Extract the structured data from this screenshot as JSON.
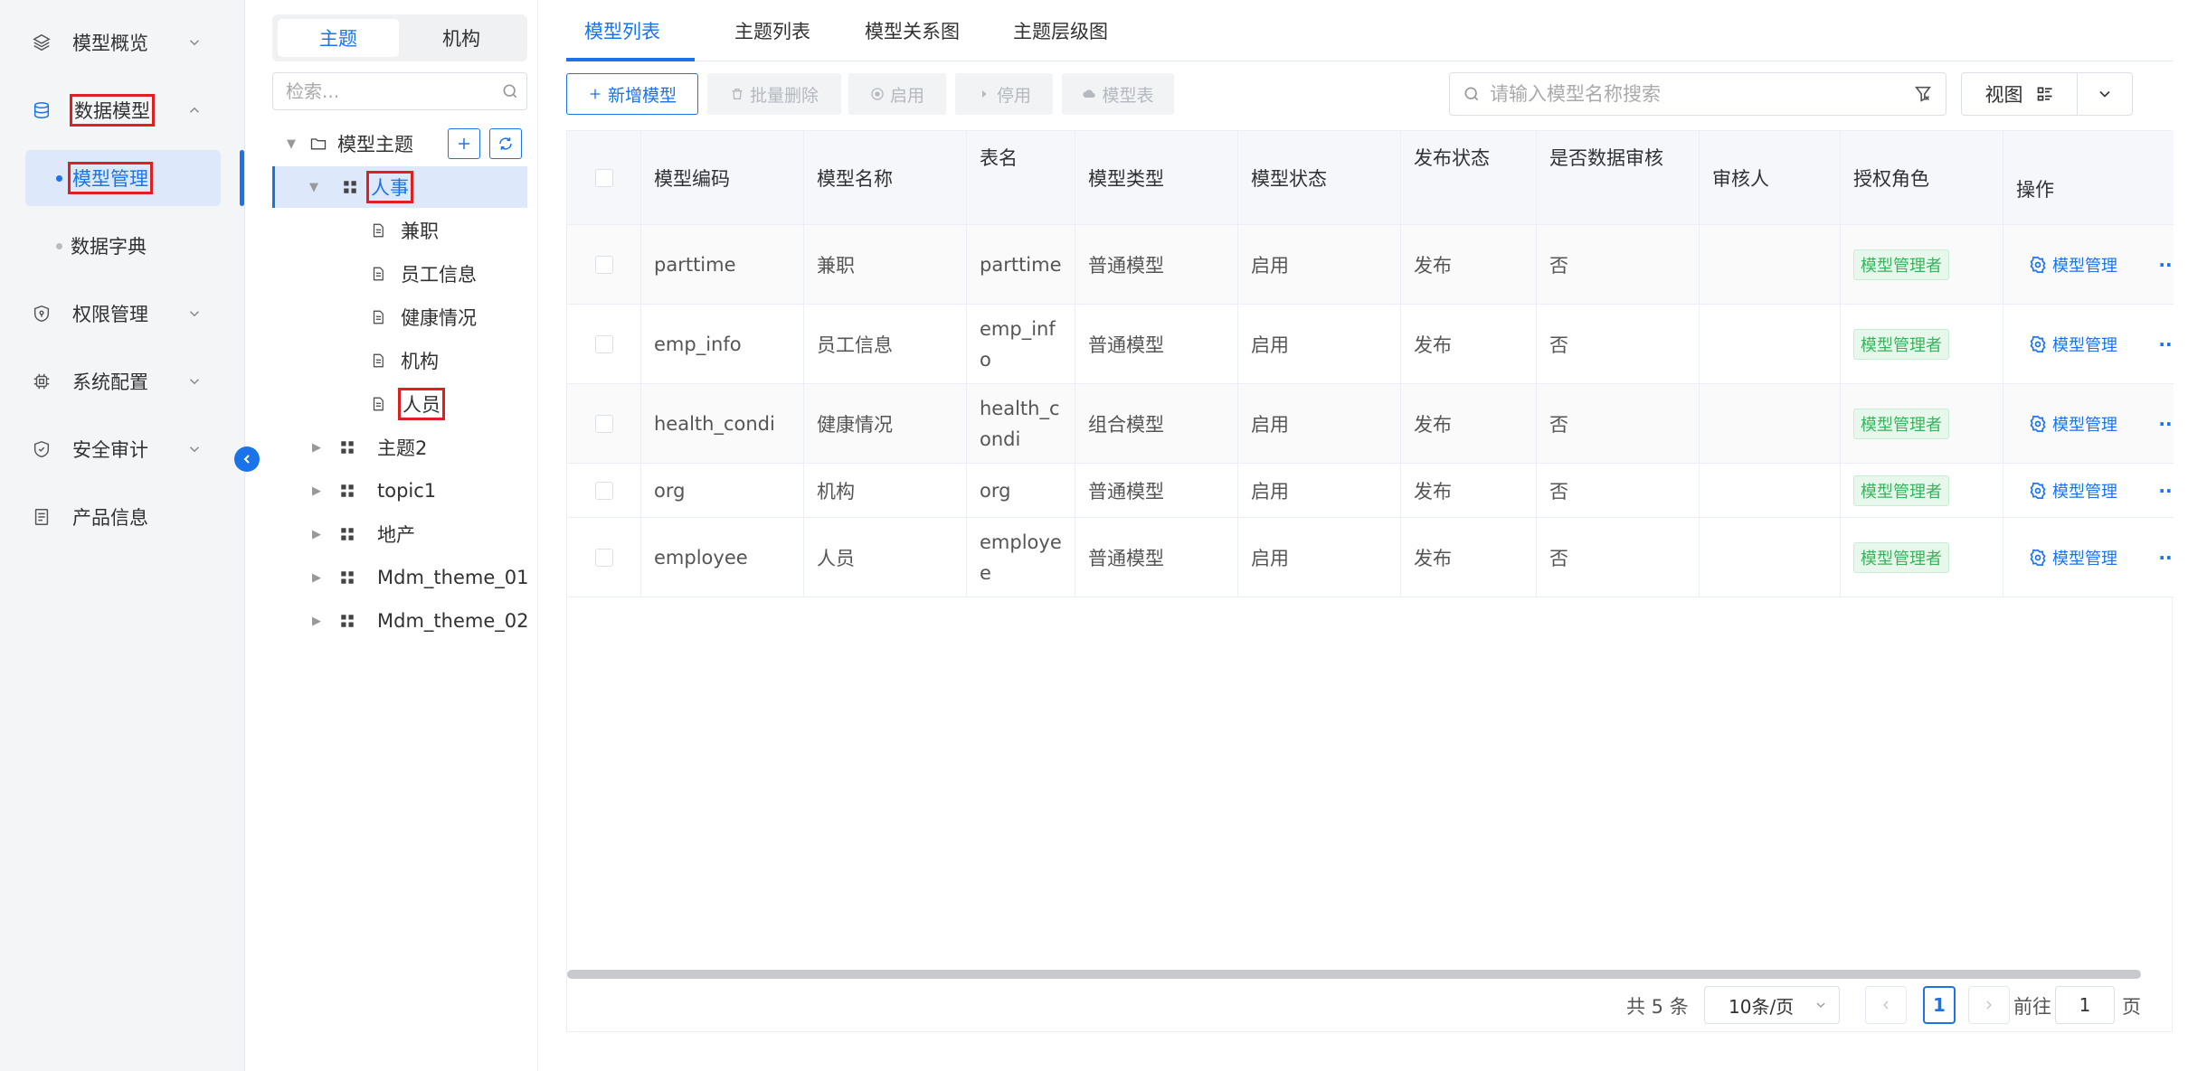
{
  "nav": {
    "items": [
      {
        "label": "模型概览"
      },
      {
        "label": "数据模型"
      },
      {
        "label": "权限管理"
      },
      {
        "label": "系统配置"
      },
      {
        "label": "安全审计"
      },
      {
        "label": "产品信息"
      }
    ],
    "sub_items": [
      {
        "label": "模型管理"
      },
      {
        "label": "数据字典"
      }
    ]
  },
  "tree": {
    "segments": [
      "主题",
      "机构"
    ],
    "search_placeholder": "检索...",
    "root": "模型主题",
    "nodes": [
      "人事",
      "兼职",
      "员工信息",
      "健康情况",
      "机构",
      "人员",
      "主题2",
      "topic1",
      "地产",
      "Mdm_theme_01",
      "Mdm_theme_02"
    ]
  },
  "tabs": [
    "模型列表",
    "主题列表",
    "模型关系图",
    "主题层级图"
  ],
  "toolbar": {
    "add": "新增模型",
    "batch_delete": "批量删除",
    "enable": "启用",
    "disable": "停用",
    "model_table": "模型表",
    "search_placeholder": "请输入模型名称搜索",
    "view": "视图"
  },
  "table": {
    "columns": [
      "模型编码",
      "模型名称",
      "表名",
      "模型类型",
      "模型状态",
      "发布状态",
      "是否数据审核",
      "审核人",
      "授权角色",
      "操作"
    ],
    "rows": [
      {
        "code": "parttime",
        "name": "兼职",
        "table": "parttime",
        "type": "普通模型",
        "status": "启用",
        "publish": "发布",
        "audit": "否",
        "auditor": "",
        "role": "模型管理者",
        "op": "模型管理"
      },
      {
        "code": "emp_info",
        "name": "员工信息",
        "table": "emp_info",
        "type": "普通模型",
        "status": "启用",
        "publish": "发布",
        "audit": "否",
        "auditor": "",
        "role": "模型管理者",
        "op": "模型管理"
      },
      {
        "code": "health_condi",
        "name": "健康情况",
        "table": "health_condi",
        "type": "组合模型",
        "status": "启用",
        "publish": "发布",
        "audit": "否",
        "auditor": "",
        "role": "模型管理者",
        "op": "模型管理"
      },
      {
        "code": "org",
        "name": "机构",
        "table": "org",
        "type": "普通模型",
        "status": "启用",
        "publish": "发布",
        "audit": "否",
        "auditor": "",
        "role": "模型管理者",
        "op": "模型管理"
      },
      {
        "code": "employee",
        "name": "人员",
        "table": "employee",
        "type": "普通模型",
        "status": "启用",
        "publish": "发布",
        "audit": "否",
        "auditor": "",
        "role": "模型管理者",
        "op": "模型管理"
      }
    ],
    "more": "··"
  },
  "pager": {
    "total": "共 5 条",
    "size": "10条/页",
    "current": "1",
    "goto_label": "前往",
    "goto_value": "1",
    "page_suffix": "页"
  },
  "colors": {
    "primary": "#1a73e8",
    "highlight": "#e02020",
    "tag_green": "#37b35b"
  }
}
